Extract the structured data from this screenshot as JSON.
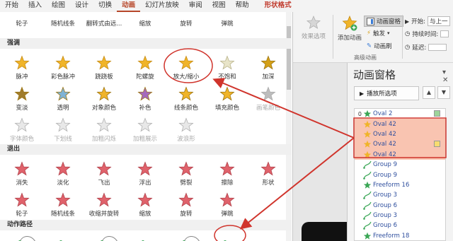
{
  "ribbon_tabs": [
    {
      "label": "开始"
    },
    {
      "label": "插入"
    },
    {
      "label": "绘图"
    },
    {
      "label": "设计"
    },
    {
      "label": "切换"
    },
    {
      "label": "动画",
      "active": true
    },
    {
      "label": "幻灯片放映"
    },
    {
      "label": "审阅"
    },
    {
      "label": "视图"
    },
    {
      "label": "帮助"
    },
    {
      "label": "形状格式",
      "shape": true
    }
  ],
  "ribbon": {
    "effect_options": "效果选项",
    "add_animation": "添加动画",
    "animation_pane": "动画窗格",
    "trigger": "触发",
    "animation_painter": "动画刷",
    "advanced_group": "高级动画",
    "start_label": "开始:",
    "start_value": "与上一",
    "duration_label": "持续时间:",
    "delay_label": "延迟:"
  },
  "gallery": {
    "top_row": [
      "轮子",
      "随机线条",
      "翻转式由远...",
      "缩放",
      "旋转",
      "弹跳"
    ],
    "emphasis_header": "强调",
    "emphasis_rows": [
      [
        "脉冲",
        "彩色脉冲",
        "跷跷板",
        "陀螺旋",
        "放大/缩小",
        "不饱和",
        "加深"
      ],
      [
        "变淡",
        "透明",
        "对象颜色",
        "补色",
        "线条颜色",
        "填充颜色",
        "画笔颜色"
      ],
      [
        "字体颜色",
        "下划线",
        "加粗闪烁",
        "加粗展示",
        "波浪形"
      ]
    ],
    "exit_header": "退出",
    "exit_rows": [
      [
        "消失",
        "淡化",
        "飞出",
        "浮出",
        "劈裂",
        "擦除",
        "形状"
      ],
      [
        "轮子",
        "随机线条",
        "收缩并旋转",
        "缩放",
        "旋转",
        "弹跳"
      ]
    ],
    "path_header": "动作路径"
  },
  "pane": {
    "title": "动画窗格",
    "play_label": "播放所选项",
    "items": [
      {
        "num": "0",
        "name": "Oval 2",
        "icon": "star-green",
        "tag": "#9ed49a",
        "hl": false
      },
      {
        "num": "",
        "name": "Oval 42",
        "icon": "star-gold",
        "tag": "",
        "hl": true
      },
      {
        "num": "",
        "name": "Oval 42",
        "icon": "star-gold",
        "tag": "",
        "hl": true
      },
      {
        "num": "",
        "name": "Oval 42",
        "icon": "star-gold",
        "tag": "#f7dc6f",
        "hl": true
      },
      {
        "num": "",
        "name": "Oval 42",
        "icon": "star-gold",
        "tag": "",
        "hl": true
      },
      {
        "num": "",
        "name": "Group 9",
        "icon": "path-green",
        "tag": "",
        "hl": false
      },
      {
        "num": "",
        "name": "Group 9",
        "icon": "path-green",
        "tag": "",
        "hl": false
      },
      {
        "num": "",
        "name": "Freeform 16",
        "icon": "star-green",
        "tag": "",
        "hl": false
      },
      {
        "num": "",
        "name": "Group 3",
        "icon": "path-green",
        "tag": "",
        "hl": false
      },
      {
        "num": "",
        "name": "Group 6",
        "icon": "path-green",
        "tag": "",
        "hl": false
      },
      {
        "num": "",
        "name": "Group 3",
        "icon": "path-green",
        "tag": "",
        "hl": false
      },
      {
        "num": "",
        "name": "Group 6",
        "icon": "path-green",
        "tag": "",
        "hl": false
      },
      {
        "num": "",
        "name": "Freeform 18",
        "icon": "star-green",
        "tag": "",
        "hl": false
      }
    ]
  },
  "colors": {
    "accent": "#b7472a",
    "highlight": "#f9c4b1",
    "annotation": "#d0342c",
    "emphasis_gold": "#f0b429",
    "exit_red": "#e0626b",
    "entrance_green": "#3aa655"
  }
}
